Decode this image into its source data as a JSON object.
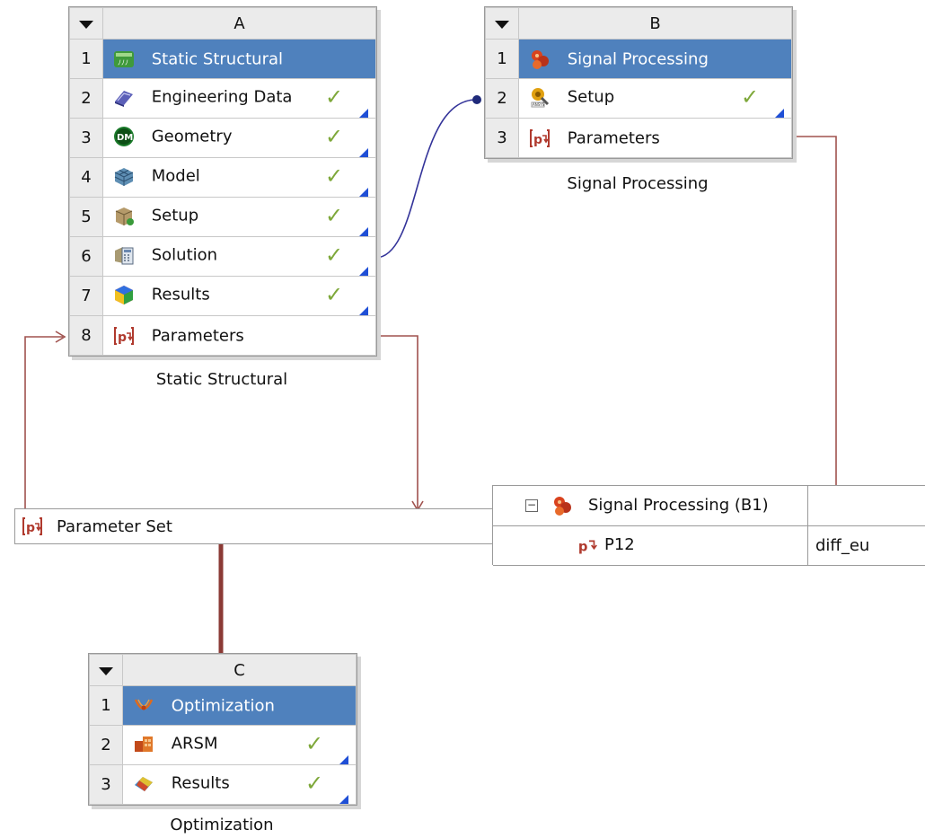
{
  "colors": {
    "title_bg": "#4f81bd",
    "header_bg": "#ebebeb",
    "check": "#7ea83a",
    "corner_marker": "#1f4fd6",
    "param_link": "#a0524e",
    "data_link": "#333399",
    "design_link": "#8b3a35"
  },
  "system_a": {
    "letter": "A",
    "caption": "Static Structural",
    "rows": [
      {
        "num": "1",
        "label": "Static Structural",
        "icon": "static-structural-icon"
      },
      {
        "num": "2",
        "label": "Engineering Data",
        "icon": "engineering-data-icon",
        "status": "check"
      },
      {
        "num": "3",
        "label": "Geometry",
        "icon": "geometry-dm-icon",
        "status": "check"
      },
      {
        "num": "4",
        "label": "Model",
        "icon": "model-mesh-icon",
        "status": "check"
      },
      {
        "num": "5",
        "label": "Setup",
        "icon": "setup-icon",
        "status": "check"
      },
      {
        "num": "6",
        "label": "Solution",
        "icon": "solution-icon",
        "status": "check"
      },
      {
        "num": "7",
        "label": "Results",
        "icon": "results-icon",
        "status": "check"
      },
      {
        "num": "8",
        "label": "Parameters",
        "icon": "parameters-icon"
      }
    ]
  },
  "system_b": {
    "letter": "B",
    "caption": "Signal Processing",
    "rows": [
      {
        "num": "1",
        "label": "Signal Processing",
        "icon": "signal-processing-icon"
      },
      {
        "num": "2",
        "label": "Setup",
        "icon": "setup-ansys-icon",
        "status": "check"
      },
      {
        "num": "3",
        "label": "Parameters",
        "icon": "parameters-icon"
      }
    ]
  },
  "system_c": {
    "letter": "C",
    "caption": "Optimization",
    "rows": [
      {
        "num": "1",
        "label": "Optimization",
        "icon": "optimization-icon"
      },
      {
        "num": "2",
        "label": "ARSM",
        "icon": "arsm-icon",
        "status": "check"
      },
      {
        "num": "3",
        "label": "Results",
        "icon": "optimization-results-icon",
        "status": "check"
      }
    ]
  },
  "parameter_set": {
    "label": "Parameter Set",
    "icon": "parameter-set-icon"
  },
  "parameter_table": {
    "group_label": "Signal Processing (B1)",
    "collapse_symbol": "−",
    "param_name": "P12",
    "param_value": "diff_eu"
  },
  "glyphs": {
    "check": "✓",
    "arrow": "→"
  }
}
